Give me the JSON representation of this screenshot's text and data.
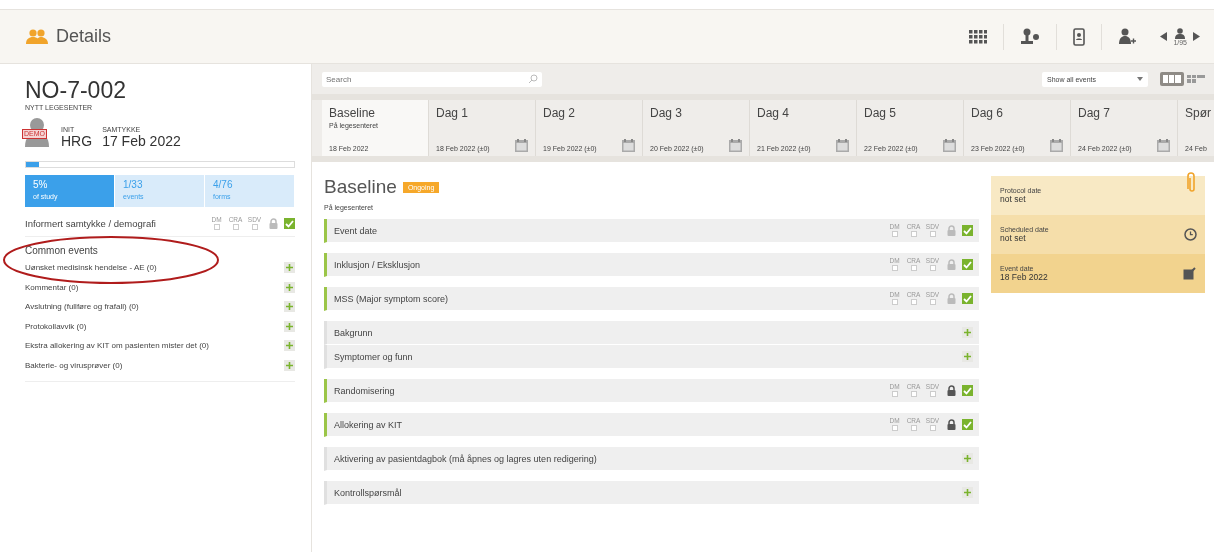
{
  "header": {
    "title": "Details",
    "pager": "1/95"
  },
  "subject": {
    "id": "NO-7-002",
    "site": "NYTT LEGESENTER",
    "avatar_badge": "DEMO",
    "init_label": "INIT",
    "init": "HRG",
    "consent_label": "SAMTYKKE",
    "consent": "17 Feb 2022",
    "progress": {
      "level": 0.05
    },
    "stats": [
      {
        "value": "5%",
        "label": "of study",
        "selected": true
      },
      {
        "value": "1/33",
        "label": "events",
        "selected": false
      },
      {
        "value": "4/76",
        "label": "forms",
        "selected": false
      }
    ]
  },
  "consent_form": {
    "label": "Informert samtykke / demografi",
    "flags": [
      "DM",
      "CRA",
      "SDV"
    ],
    "locked": false,
    "complete": true
  },
  "common_events": {
    "title": "Common events",
    "items": [
      "Uønsket medisinsk hendelse - AE (0)",
      "Kommentar (0)",
      "Avslutning (fullføre og frafall) (0)",
      "Protokollavvik (0)",
      "Ekstra allokering av KIT om pasienten mister det (0)",
      "Bakterie- og virusprøver (0)"
    ]
  },
  "toolbar": {
    "search_placeholder": "Search",
    "filter": "Show all events"
  },
  "timeline": [
    {
      "name": "Baseline",
      "subtitle": "På legesenteret",
      "date": "18 Feb 2022",
      "selected": true,
      "calendar": false
    },
    {
      "name": "Dag 1",
      "date": "18 Feb 2022 (±0)",
      "selected": false,
      "calendar": true
    },
    {
      "name": "Dag 2",
      "date": "19 Feb 2022 (±0)",
      "selected": false,
      "calendar": true
    },
    {
      "name": "Dag 3",
      "date": "20 Feb 2022 (±0)",
      "selected": false,
      "calendar": true
    },
    {
      "name": "Dag 4",
      "date": "21 Feb 2022 (±0)",
      "selected": false,
      "calendar": true
    },
    {
      "name": "Dag 5",
      "date": "22 Feb 2022 (±0)",
      "selected": false,
      "calendar": true
    },
    {
      "name": "Dag 6",
      "date": "23 Feb 2022 (±0)",
      "selected": false,
      "calendar": true
    },
    {
      "name": "Dag 7",
      "date": "24 Feb 2022 (±0)",
      "selected": false,
      "calendar": true
    },
    {
      "name": "Spør",
      "date": "24 Feb",
      "selected": false,
      "calendar": false
    }
  ],
  "event": {
    "title": "Baseline",
    "status": "Ongoing",
    "subtitle": "På legesenteret",
    "groups": [
      [
        {
          "name": "Event date",
          "kind": "form",
          "flags": [
            "DM",
            "CRA",
            "SDV"
          ],
          "locked": false,
          "complete": true
        }
      ],
      [
        {
          "name": "Inklusjon / Eksklusjon",
          "kind": "form",
          "flags": [
            "DM",
            "CRA",
            "SDV"
          ],
          "locked": false,
          "complete": true
        }
      ],
      [
        {
          "name": "MSS (Major symptom score)",
          "kind": "form",
          "flags": [
            "DM",
            "CRA",
            "SDV"
          ],
          "locked": false,
          "complete": true
        }
      ],
      [
        {
          "name": "Bakgrunn",
          "kind": "add"
        },
        {
          "name": "Symptomer og funn",
          "kind": "add"
        }
      ],
      [
        {
          "name": "Randomisering",
          "kind": "form",
          "flags": [
            "DM",
            "CRA",
            "SDV"
          ],
          "locked": true,
          "complete": true
        }
      ],
      [
        {
          "name": "Allokering av KIT",
          "kind": "form",
          "flags": [
            "DM",
            "CRA",
            "SDV"
          ],
          "locked": true,
          "complete": true
        }
      ],
      [
        {
          "name": "Aktivering av pasientdagbok (må åpnes og lagres uten redigering)",
          "kind": "add"
        }
      ],
      [
        {
          "name": "Kontrollspørsmål",
          "kind": "add"
        }
      ]
    ]
  },
  "dates": [
    {
      "label": "Protocol date",
      "value": "not set"
    },
    {
      "label": "Scheduled date",
      "value": "not set"
    },
    {
      "label": "Event date",
      "value": "18 Feb 2022"
    }
  ]
}
